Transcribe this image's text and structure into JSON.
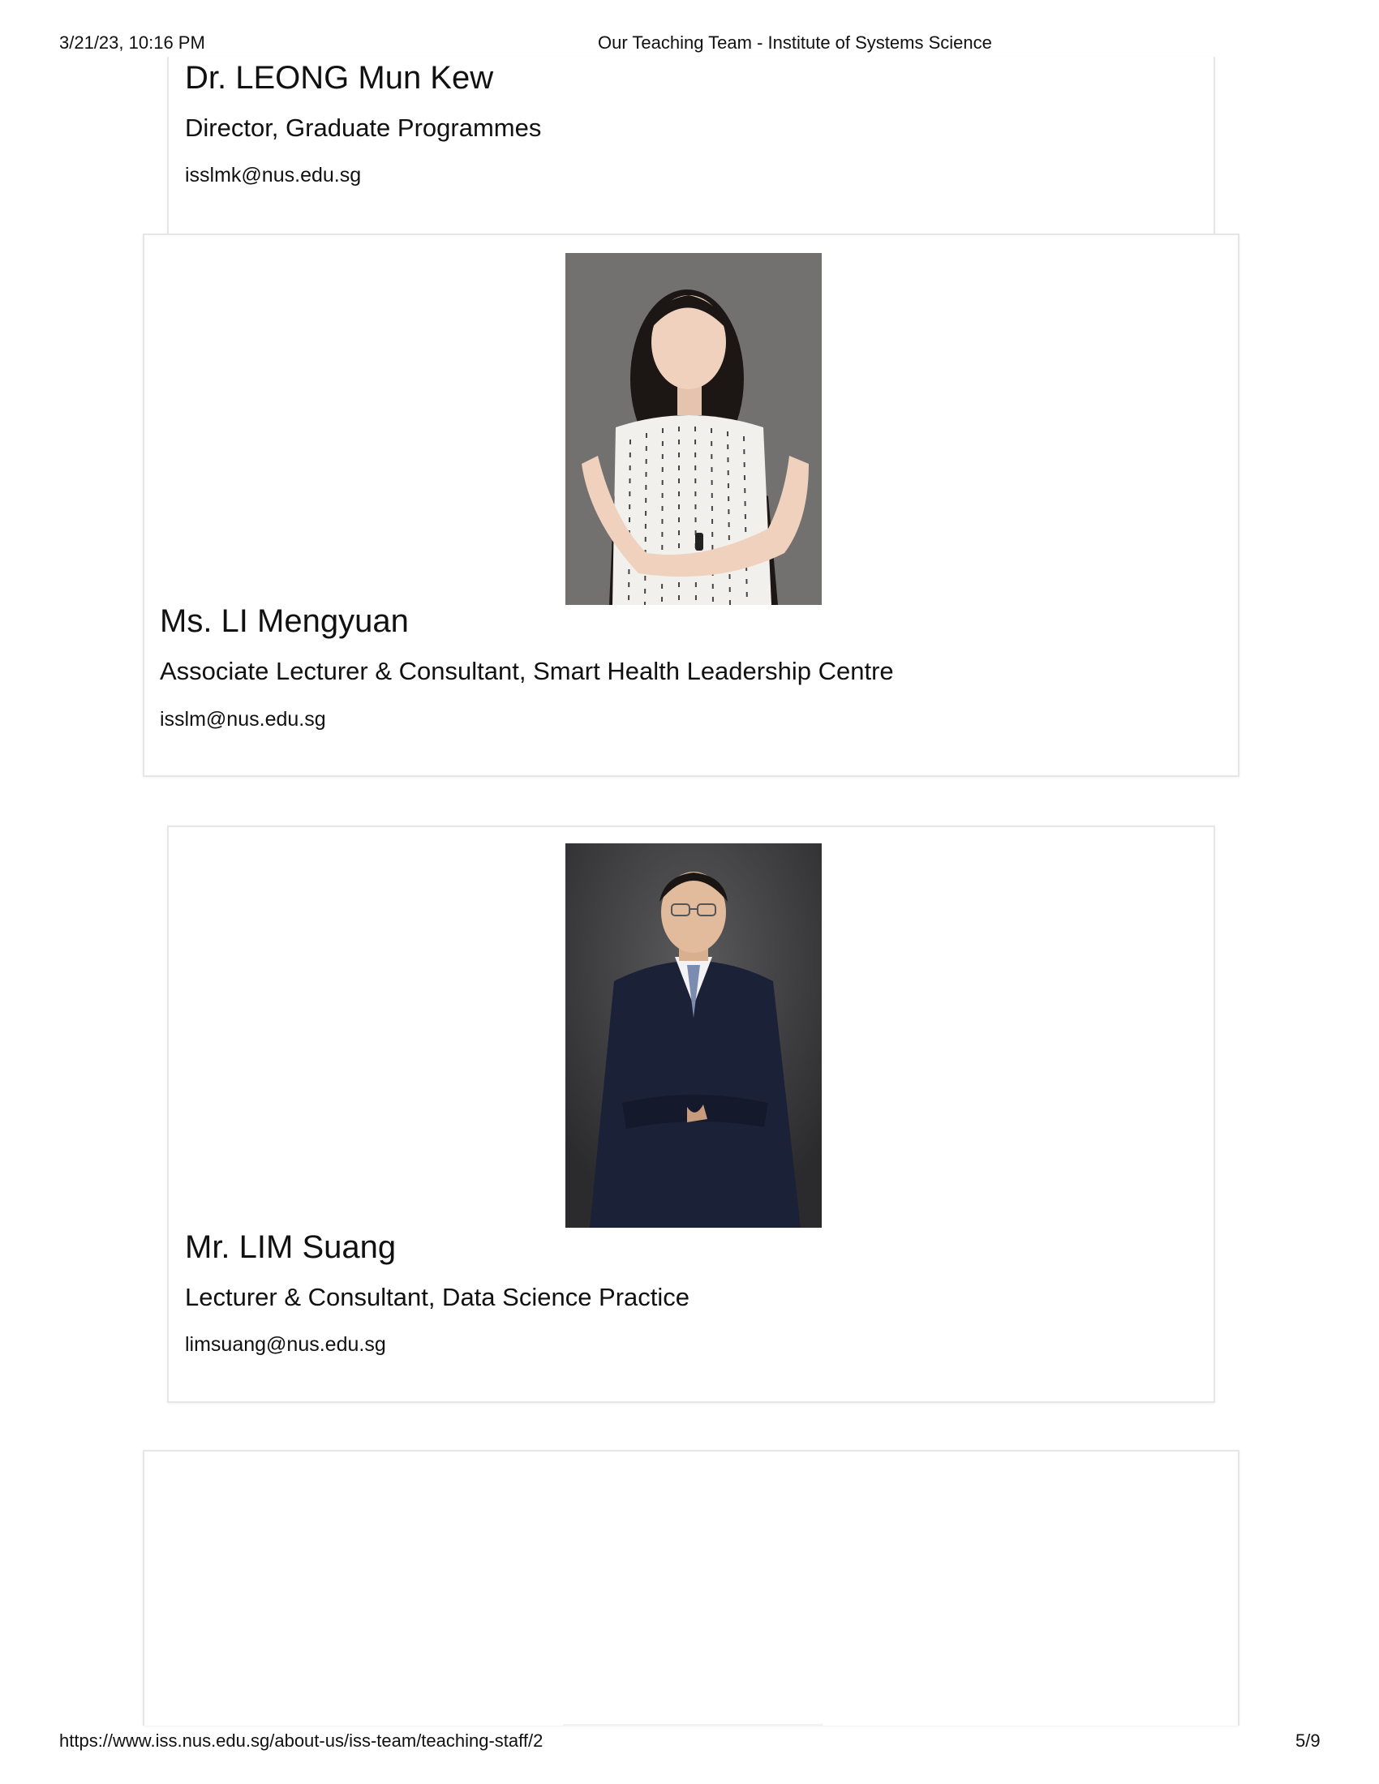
{
  "header": {
    "datetime": "3/21/23, 10:16 PM",
    "title": "Our Teaching Team - Institute of Systems Science"
  },
  "footer": {
    "url": "https://www.iss.nus.edu.sg/about-us/iss-team/teaching-staff/2",
    "page": "5/9"
  },
  "staff": [
    {
      "name": "Dr. LEONG Mun Kew",
      "title": "Director, Graduate Programmes",
      "email": "isslmk@nus.edu.sg"
    },
    {
      "name": "Ms. LI Mengyuan",
      "title": "Associate Lecturer & Consultant, Smart Health Leadership Centre",
      "email": "isslm@nus.edu.sg"
    },
    {
      "name": "Mr. LIM Suang",
      "title": "Lecturer & Consultant, Data Science Practice",
      "email": "limsuang@nus.edu.sg"
    }
  ]
}
